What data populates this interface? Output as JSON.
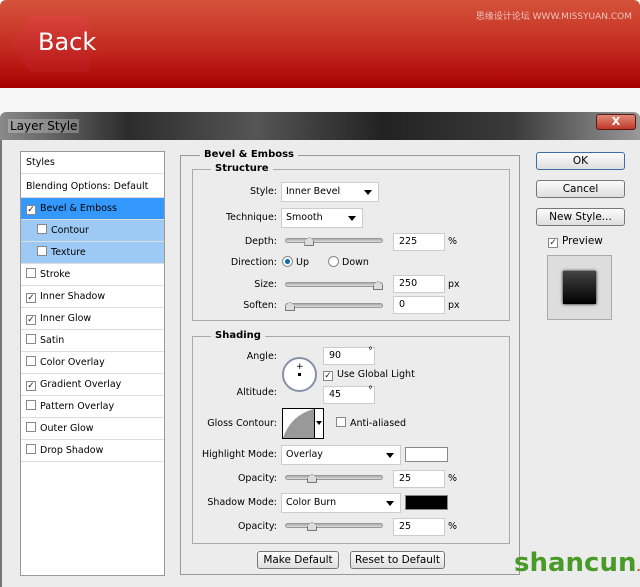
{
  "header": {
    "back_label": "Back",
    "watermark": "思缘设计论坛 WWW.MISSYUAN.COM"
  },
  "dialog": {
    "title": "Layer Style",
    "close_label": "X"
  },
  "styles_panel": {
    "title": "Styles",
    "items": [
      {
        "label": "Blending Options: Default",
        "checkbox": false
      },
      {
        "label": "Bevel & Emboss",
        "checkbox": true,
        "checked": true,
        "selected": true
      },
      {
        "label": "Contour",
        "checkbox": true,
        "checked": false,
        "sub": true
      },
      {
        "label": "Texture",
        "checkbox": true,
        "checked": false,
        "sub": true
      },
      {
        "label": "Stroke",
        "checkbox": true,
        "checked": false
      },
      {
        "label": "Inner Shadow",
        "checkbox": true,
        "checked": true
      },
      {
        "label": "Inner Glow",
        "checkbox": true,
        "checked": true
      },
      {
        "label": "Satin",
        "checkbox": true,
        "checked": false
      },
      {
        "label": "Color Overlay",
        "checkbox": true,
        "checked": false
      },
      {
        "label": "Gradient Overlay",
        "checkbox": true,
        "checked": true
      },
      {
        "label": "Pattern Overlay",
        "checkbox": true,
        "checked": false
      },
      {
        "label": "Outer Glow",
        "checkbox": true,
        "checked": false
      },
      {
        "label": "Drop Shadow",
        "checkbox": true,
        "checked": false
      }
    ]
  },
  "bevel": {
    "title": "Bevel & Emboss",
    "structure": {
      "title": "Structure",
      "style_label": "Style:",
      "style": "Inner Bevel",
      "technique_label": "Technique:",
      "technique": "Smooth",
      "depth_label": "Depth:",
      "depth": "225",
      "depth_unit": "%",
      "depth_fraction": 0.22,
      "direction_label": "Direction:",
      "up": "Up",
      "down": "Down",
      "direction": "Up",
      "size_label": "Size:",
      "size": "250",
      "size_unit": "px",
      "size_fraction": 1.0,
      "soften_label": "Soften:",
      "soften": "0",
      "soften_unit": "px",
      "soften_fraction": 0
    }
  },
  "shading": {
    "title": "Shading",
    "angle_label": "Angle:",
    "angle": "90",
    "deg": "°",
    "altitude_label": "Altitude:",
    "altitude": "45",
    "global_light": "Use Global Light",
    "global_light_checked": true,
    "gloss_label": "Gloss Contour:",
    "anti_aliased": "Anti-aliased",
    "anti_aliased_checked": false,
    "highlight_label": "Highlight Mode:",
    "highlight_mode": "Overlay",
    "highlight_color": "#ffffff",
    "opacity_label": "Opacity:",
    "highlight_opacity": "25",
    "pct": "%",
    "highlight_opacity_fraction": 0.25,
    "shadow_label": "Shadow Mode:",
    "shadow_mode": "Color Burn",
    "shadow_color": "#000000",
    "shadow_opacity": "25",
    "shadow_opacity_fraction": 0.25
  },
  "make_default": "Make Default",
  "reset_default": "Reset to Default",
  "buttons": {
    "ok": "OK",
    "cancel": "Cancel",
    "new_style": "New Style...",
    "preview": "Preview"
  },
  "footer_logo": "shancun.net"
}
